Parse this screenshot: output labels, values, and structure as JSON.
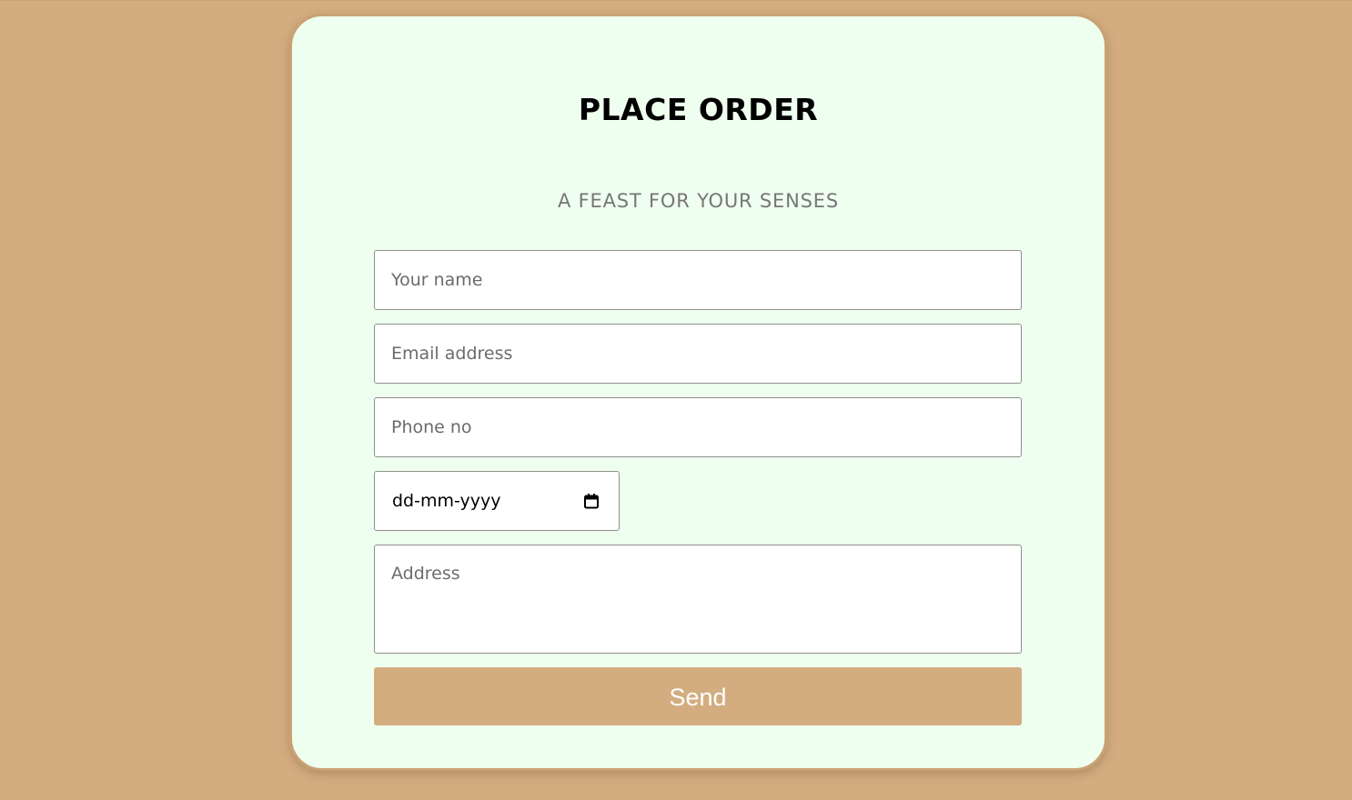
{
  "form": {
    "title": "PLACE ORDER",
    "subtitle": "A FEAST FOR YOUR SENSES",
    "name_placeholder": "Your name",
    "email_placeholder": "Email address",
    "phone_placeholder": "Phone no",
    "date_value": "dd-mm-yyyy",
    "date_icon": "calendar-icon",
    "address_placeholder": "Address",
    "send_label": "Send"
  },
  "colors": {
    "background": "#d3ad80",
    "card": "#efffef",
    "card_border": "#c9a274",
    "button": "#d3ad80",
    "button_text": "#ffffff",
    "subtitle": "#767676"
  }
}
